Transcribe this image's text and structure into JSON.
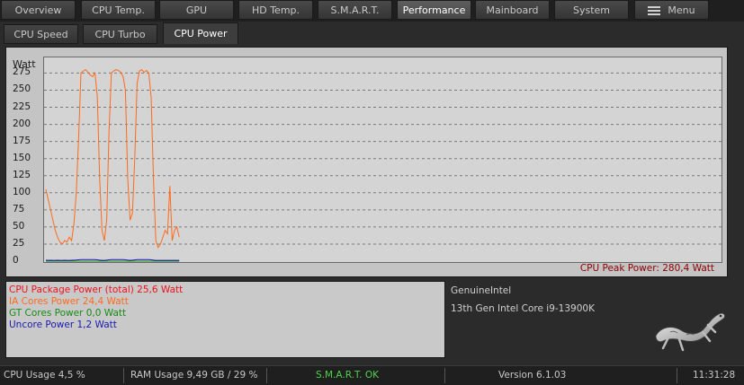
{
  "nav": {
    "tabs": [
      {
        "label": "Overview"
      },
      {
        "label": "CPU Temp."
      },
      {
        "label": "GPU"
      },
      {
        "label": "HD Temp."
      },
      {
        "label": "S.M.A.R.T."
      },
      {
        "label": "Performance"
      },
      {
        "label": "Mainboard"
      },
      {
        "label": "System"
      },
      {
        "label": "Menu"
      }
    ],
    "active_tab": "Performance"
  },
  "subtabs": [
    {
      "label": "CPU Speed"
    },
    {
      "label": "CPU Turbo"
    },
    {
      "label": "CPU Power"
    }
  ],
  "active_subtab": "CPU Power",
  "chart_data": {
    "type": "line",
    "ylabel": "Watt",
    "ylim": [
      0,
      290
    ],
    "yticks": [
      "0",
      "25",
      "50",
      "75",
      "100",
      "125",
      "150",
      "175",
      "200",
      "225",
      "250",
      "275"
    ],
    "grid": "dashed horizontal",
    "annotation": "CPU Peak Power: 280,4 Watt",
    "series": [
      {
        "name": "IA Cores Power",
        "color": "#ff6a1a",
        "values": [
          105,
          90,
          75,
          60,
          45,
          35,
          28,
          25,
          30,
          28,
          35,
          30,
          55,
          100,
          180,
          275,
          278,
          280,
          276,
          272,
          270,
          275,
          240,
          120,
          45,
          30,
          60,
          190,
          275,
          278,
          280,
          279,
          276,
          270,
          250,
          120,
          60,
          70,
          150,
          260,
          278,
          280,
          276,
          279,
          275,
          240,
          120,
          30,
          20,
          25,
          35,
          45,
          40,
          110,
          30,
          45,
          50,
          35
        ],
        "step": 1
      },
      {
        "name": "GT Cores Power",
        "color": "#1a8a1a",
        "values": [
          0,
          0,
          0,
          0,
          0,
          0,
          0,
          0,
          0,
          0,
          0,
          0,
          0,
          0,
          0,
          0,
          0,
          0,
          0,
          0,
          0,
          0,
          0,
          0,
          0,
          0,
          0,
          0,
          0,
          0,
          0,
          0,
          0,
          0,
          0,
          0,
          0,
          0,
          0,
          0,
          0,
          0,
          0,
          0,
          0,
          0,
          0,
          0,
          0,
          0,
          0,
          0,
          0,
          0,
          0,
          0,
          0,
          0
        ]
      },
      {
        "name": "Uncore Power",
        "color": "#1a1ab4",
        "values": [
          1.5,
          1.2,
          1.3,
          1.2,
          1.2,
          1.3,
          1.2,
          1.2,
          1.3,
          1.2,
          1.2,
          1.3,
          1.4,
          1.6,
          2,
          2.2,
          2.3,
          2.2,
          2.2,
          2.2,
          2.2,
          2.2,
          2,
          1.5,
          1.2,
          1.2,
          1.4,
          2,
          2.2,
          2.3,
          2.3,
          2.2,
          2.2,
          2.2,
          2,
          1.5,
          1.3,
          1.4,
          1.8,
          2.2,
          2.3,
          2.2,
          2.2,
          2.2,
          2.2,
          2,
          1.5,
          1.2,
          1.2,
          1.2,
          1.2,
          1.2,
          1.2,
          1.2,
          1.2,
          1.2,
          1.2,
          1.2
        ]
      }
    ]
  },
  "legend": [
    {
      "text": "CPU Package Power (total) 25,6 Watt",
      "color": "#e8141e"
    },
    {
      "text": "IA Cores Power 24,4 Watt",
      "color": "#ff6a1a"
    },
    {
      "text": "GT Cores Power 0,0 Watt",
      "color": "#1a8a1a"
    },
    {
      "text": "Uncore Power 1,2 Watt",
      "color": "#1a1ab4"
    }
  ],
  "info": {
    "vendor": "GenuineIntel",
    "model": "13th Gen Intel Core i9-13900K"
  },
  "status": {
    "cpu_usage": "CPU Usage 4,5 %",
    "ram_usage": "RAM Usage 9,49 GB / 29 %",
    "smart": "S.M.A.R.T. OK",
    "smart_color": "#4cd44c",
    "version": "Version 6.1.03",
    "time": "11:31:28"
  },
  "colors": {
    "peak": "#8b0000"
  }
}
